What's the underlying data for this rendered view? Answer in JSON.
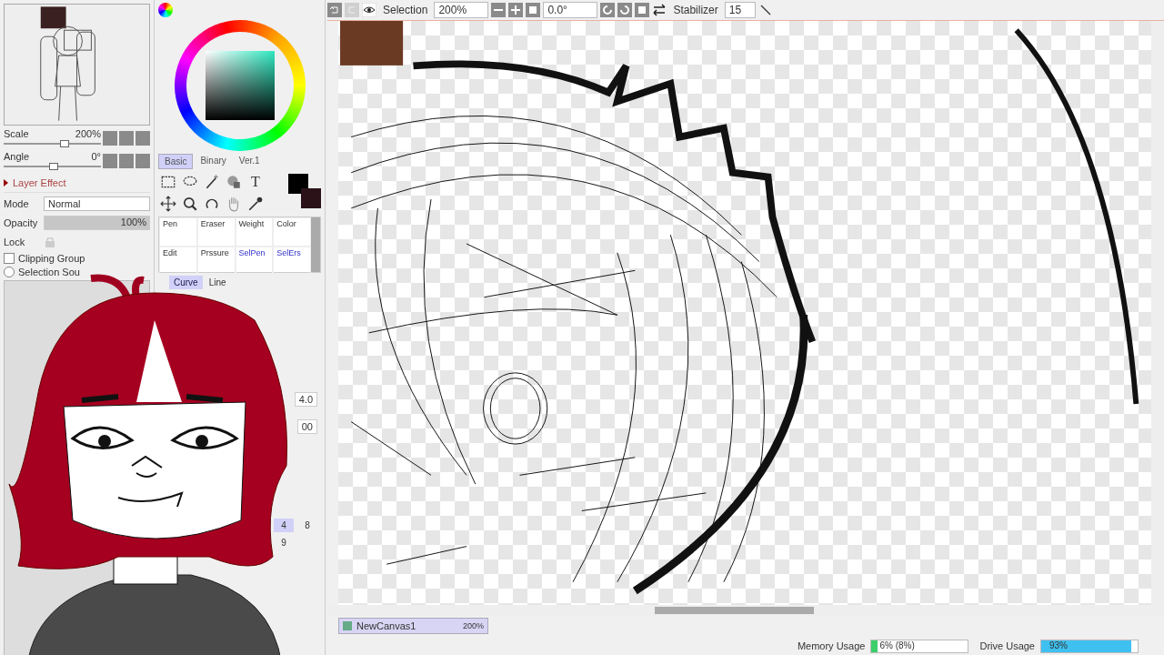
{
  "navigator": {
    "scale": {
      "label": "Scale",
      "reading": "200%",
      "level": 0.62
    },
    "angle": {
      "label": "Angle",
      "reading": "0°",
      "level": 0.5
    }
  },
  "layer_effect": {
    "title": "Layer Effect"
  },
  "mode": {
    "label": "Mode",
    "value": "Normal"
  },
  "opacity": {
    "label": "Opacity",
    "reading": "100%",
    "level": 1
  },
  "lock": {
    "label": "Lock"
  },
  "options": [
    {
      "kind": "checkbox",
      "label": "Clipping Group",
      "checked": false
    },
    {
      "kind": "radio",
      "label": "Selection Sou",
      "checked": false
    }
  ],
  "text_tool": "T",
  "color_tabs": [
    {
      "label": "Basic",
      "selected": true
    },
    {
      "label": "Binary",
      "selected": false
    },
    {
      "label": "Ver.1",
      "selected": false
    }
  ],
  "brush_tools": [
    {
      "label": "Pen",
      "kind": "paint"
    },
    {
      "label": "Eraser",
      "kind": "paint"
    },
    {
      "label": "Weight",
      "kind": "paint"
    },
    {
      "label": "Color",
      "kind": "paint"
    },
    {
      "label": "Edit",
      "kind": "paint"
    },
    {
      "label": "Prssure",
      "kind": "paint"
    },
    {
      "label": "SelPen",
      "kind": "select"
    },
    {
      "label": "SelErs",
      "kind": "select"
    }
  ],
  "curve_tabs": [
    {
      "label": "Curve",
      "selected": true
    },
    {
      "label": "Line",
      "selected": false
    }
  ],
  "brush_readings": [
    "4.0",
    "00"
  ],
  "brush_sizes": [
    {
      "label": "4",
      "selected": true
    },
    {
      "label": "8",
      "selected": false
    },
    {
      "label": "9",
      "selected": false
    }
  ],
  "toolbar": {
    "selection_label": "Selection",
    "zoom": "200%",
    "angle": "0.0°",
    "stabilizer_label": "Stabilizer",
    "stabilizer": "15"
  },
  "canvas_tabs": [
    {
      "label": "NewCanvas1",
      "zoom": "200%",
      "selected": true
    }
  ],
  "status": [
    {
      "label": "Memory Usage",
      "reading": "6% (8%)",
      "level": 0.06,
      "color": "#3ccf6a"
    },
    {
      "label": "Drive Usage",
      "reading": "93%",
      "level": 0.93,
      "color": "#3ec0f0"
    }
  ]
}
